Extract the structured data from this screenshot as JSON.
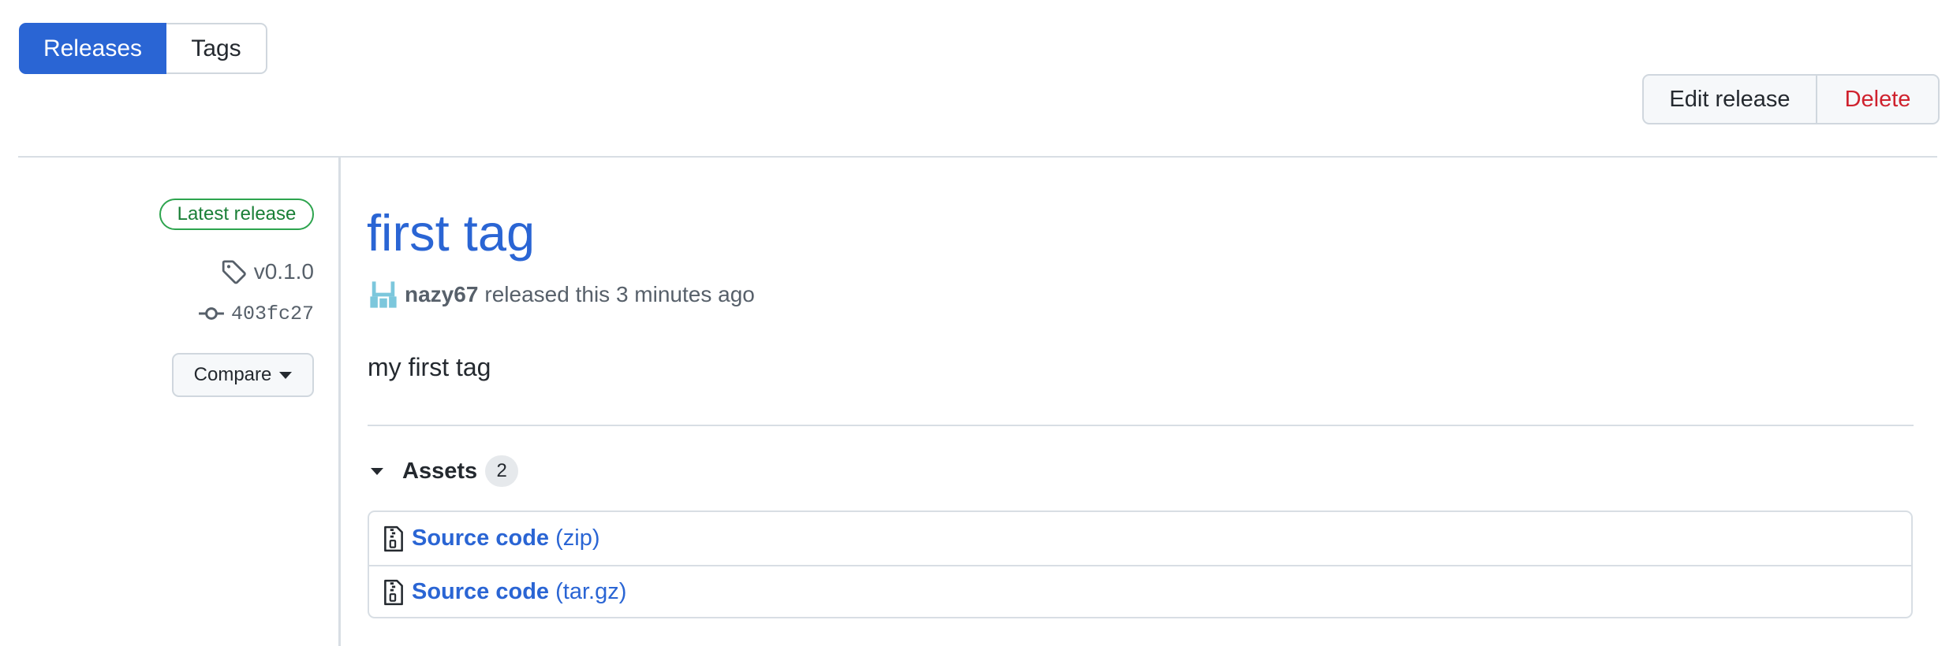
{
  "tabs": {
    "releases": "Releases",
    "tags": "Tags"
  },
  "actions": {
    "edit": "Edit release",
    "delete": "Delete"
  },
  "release": {
    "badge": "Latest release",
    "tag": "v0.1.0",
    "commit": "403fc27",
    "compare": "Compare",
    "title": "first tag",
    "author": "nazy67",
    "byline": "released this 3 minutes ago",
    "body": "my first tag"
  },
  "assets": {
    "label": "Assets",
    "count": "2",
    "items": [
      {
        "name": "Source code",
        "ext": "(zip)"
      },
      {
        "name": "Source code",
        "ext": "(tar.gz)"
      }
    ]
  },
  "colors": {
    "accent": "#2a65d4",
    "danger": "#cf222e",
    "success": "#1a7f37"
  }
}
